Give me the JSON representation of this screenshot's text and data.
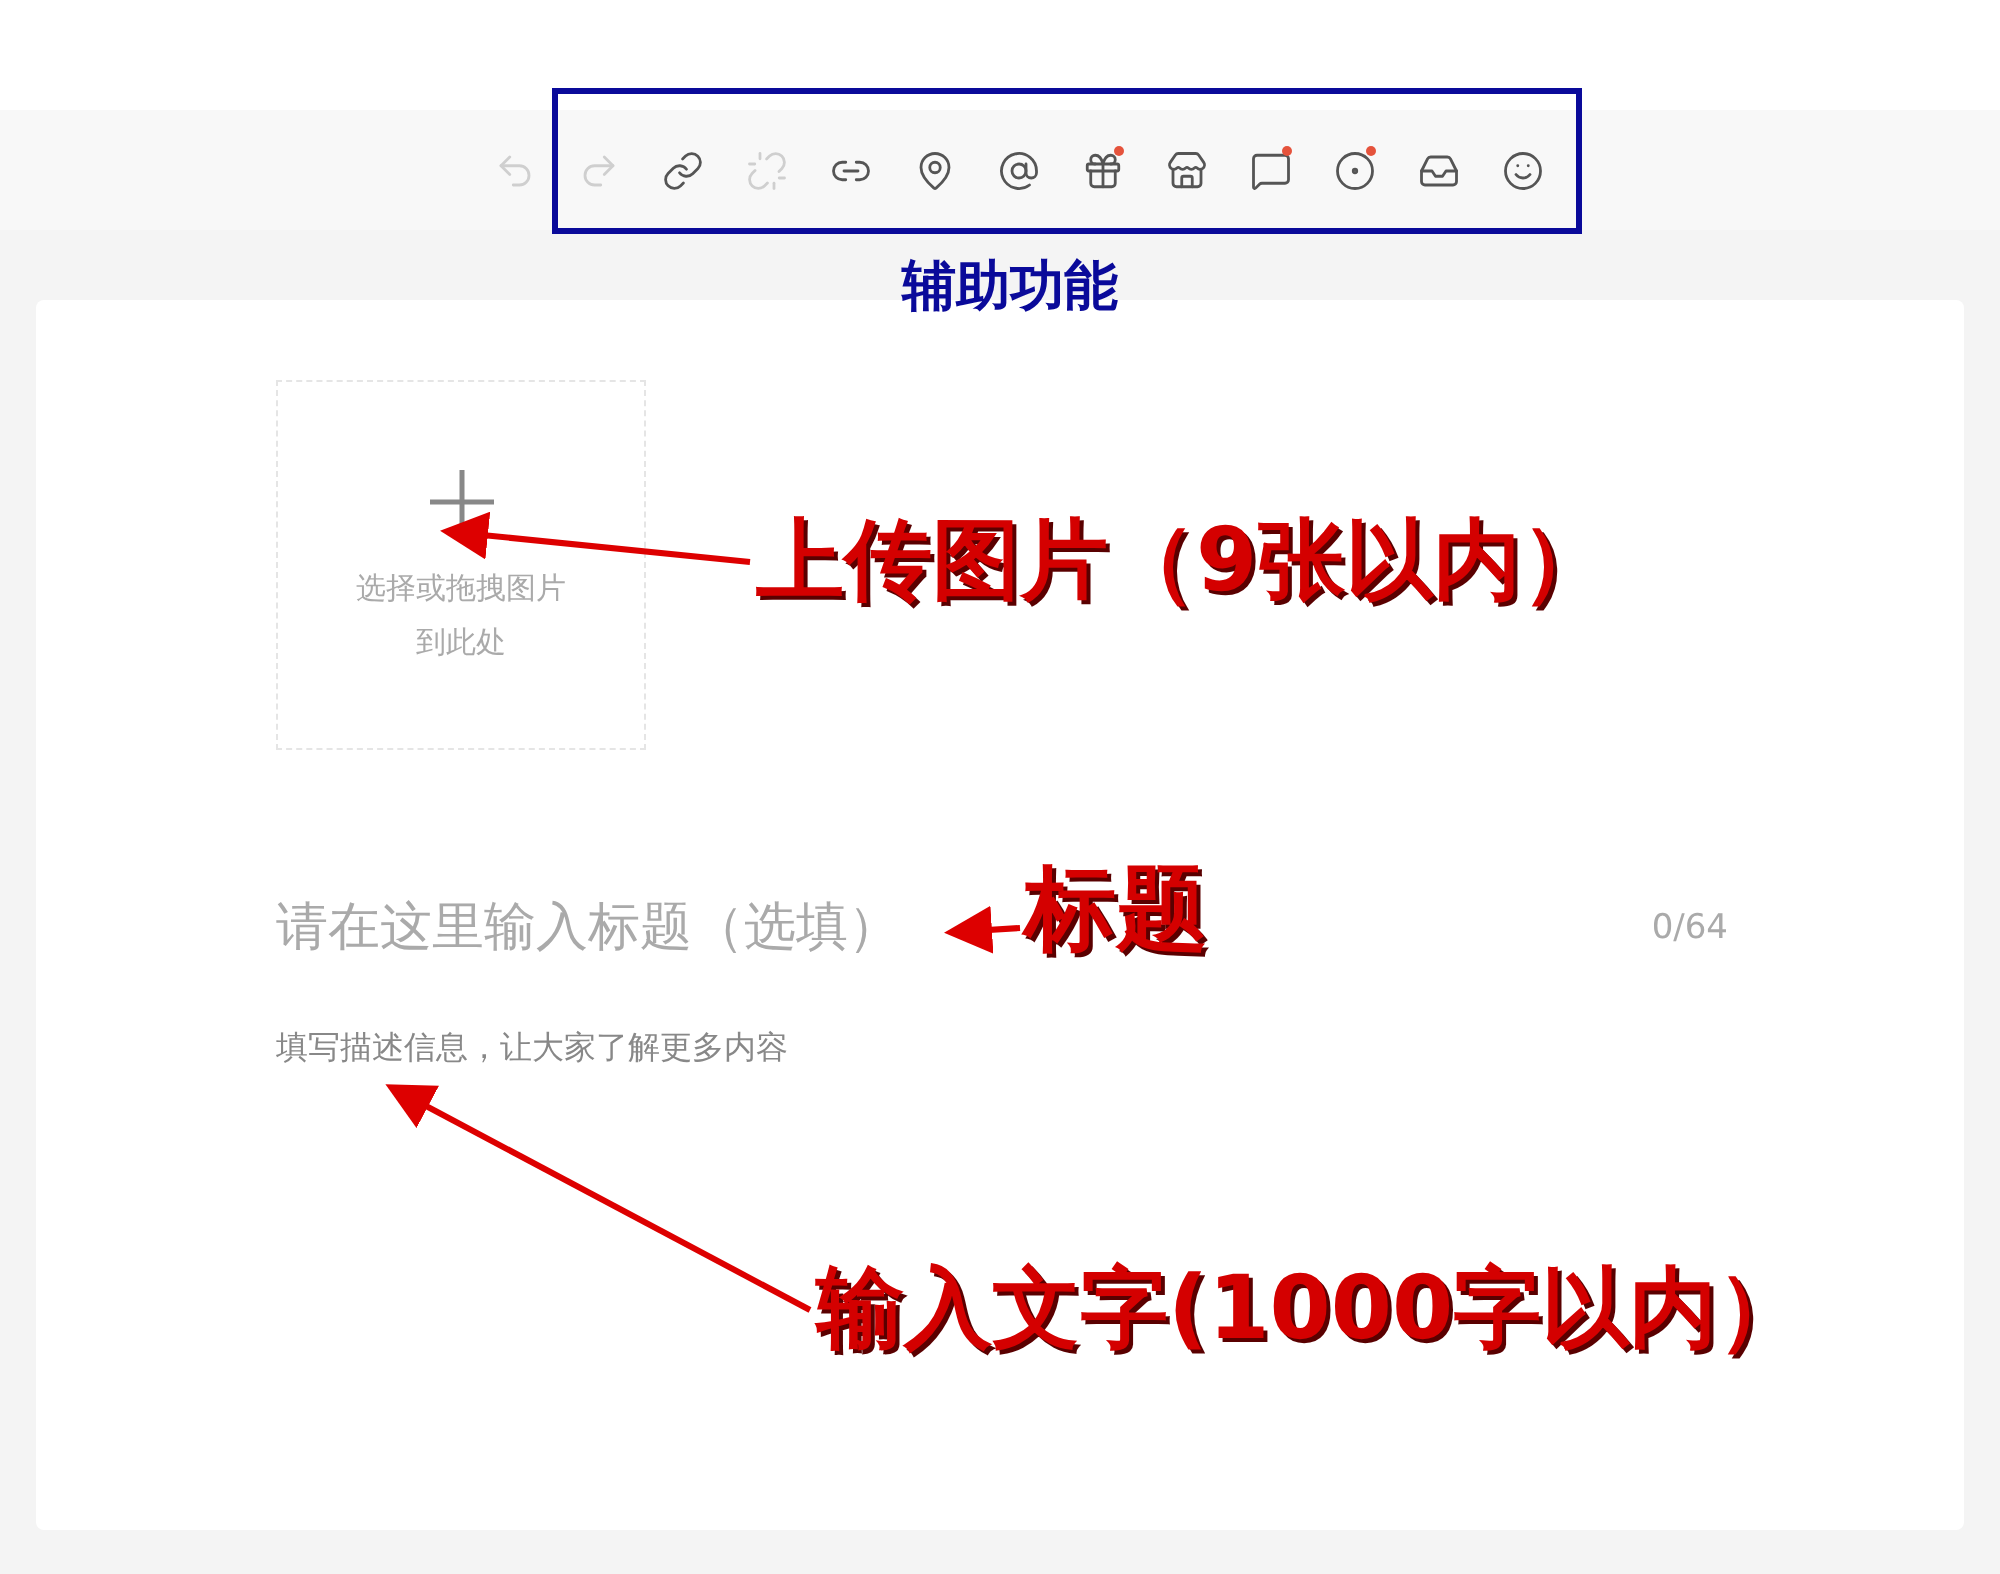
{
  "toolbar": {
    "buttons": [
      {
        "kind": "undo",
        "disabled": true,
        "badge": false
      },
      {
        "kind": "redo",
        "disabled": true,
        "badge": false
      },
      {
        "kind": "link",
        "disabled": false,
        "badge": false
      },
      {
        "kind": "unlink",
        "disabled": true,
        "badge": false
      },
      {
        "kind": "mini-link",
        "disabled": false,
        "badge": false
      },
      {
        "kind": "location",
        "disabled": false,
        "badge": false
      },
      {
        "kind": "mention",
        "disabled": false,
        "badge": false
      },
      {
        "kind": "gift",
        "disabled": false,
        "badge": true
      },
      {
        "kind": "store",
        "disabled": false,
        "badge": false
      },
      {
        "kind": "message",
        "disabled": false,
        "badge": true
      },
      {
        "kind": "target",
        "disabled": false,
        "badge": true
      },
      {
        "kind": "inbox",
        "disabled": false,
        "badge": false
      },
      {
        "kind": "emoji",
        "disabled": false,
        "badge": false
      }
    ]
  },
  "annotations": {
    "toolbar_label": "辅助功能",
    "upload_label": "上传图片（9张以内）",
    "title_label": "标题",
    "text_label": "输入文字(1000字以内）"
  },
  "editor": {
    "upload": {
      "hint": "选择或拖拽图片到此处"
    },
    "title": {
      "placeholder": "请在这里输入标题（选填）",
      "counter": "0/64"
    },
    "description": {
      "placeholder": "填写描述信息，让大家了解更多内容"
    }
  }
}
